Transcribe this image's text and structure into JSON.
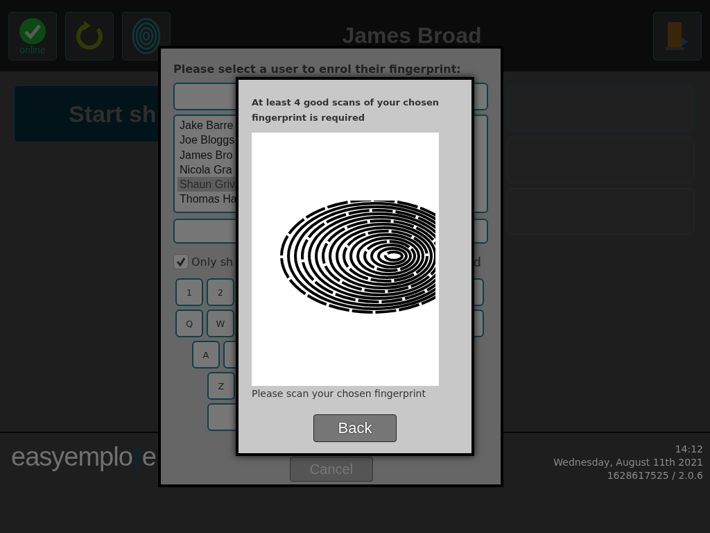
{
  "header": {
    "status_button": {
      "label": "online"
    },
    "title": "James Broad"
  },
  "page": {
    "start_button": "Start sh",
    "cards": [
      {
        "highlighted": true
      },
      {
        "highlighted": false
      },
      {
        "highlighted": false
      }
    ]
  },
  "enrol_dialog": {
    "title": "Please select a user to enrol their fingerprint:",
    "users": [
      {
        "name": "Jake Barre",
        "selected": false
      },
      {
        "name": "Joe Bloggs",
        "selected": false
      },
      {
        "name": "James Bro",
        "selected": false
      },
      {
        "name": "Nicola Gra",
        "selected": false
      },
      {
        "name": "Shaun Griv",
        "selected": true
      },
      {
        "name": "Thomas Ha",
        "selected": false
      }
    ],
    "filter": {
      "label": "Only sh",
      "label_end": "d",
      "checked": true
    },
    "keyboard": [
      {
        "keys": [
          {
            "kind": "letter",
            "label": "1"
          },
          {
            "kind": "letter",
            "label": "2"
          }
        ],
        "trailing_key": true
      },
      {
        "keys": [
          {
            "kind": "letter",
            "label": "Q"
          },
          {
            "kind": "letter",
            "label": "W"
          }
        ],
        "trailing_key": true
      },
      {
        "keys": [
          {
            "kind": "letter",
            "label": "A"
          },
          {
            "kind": "blank"
          }
        ],
        "trailing_key": false
      },
      {
        "keys": [
          {
            "kind": "letter",
            "label": "Z"
          }
        ],
        "trailing_key": false
      },
      {
        "keys": [
          {
            "kind": "wide"
          }
        ],
        "trailing_key": false
      }
    ],
    "cancel": "Cancel"
  },
  "scan_dialog": {
    "message": "At least 4 good scans of your chosen fingerprint is required",
    "caption": "Please scan your chosen fingerprint",
    "back": "Back"
  },
  "footer": {
    "logo": [
      "easyemplo",
      "e"
    ],
    "time": "14:12",
    "date": "Wednesday, August 11th 2021",
    "version": "1628617525 / 2.0.6"
  }
}
